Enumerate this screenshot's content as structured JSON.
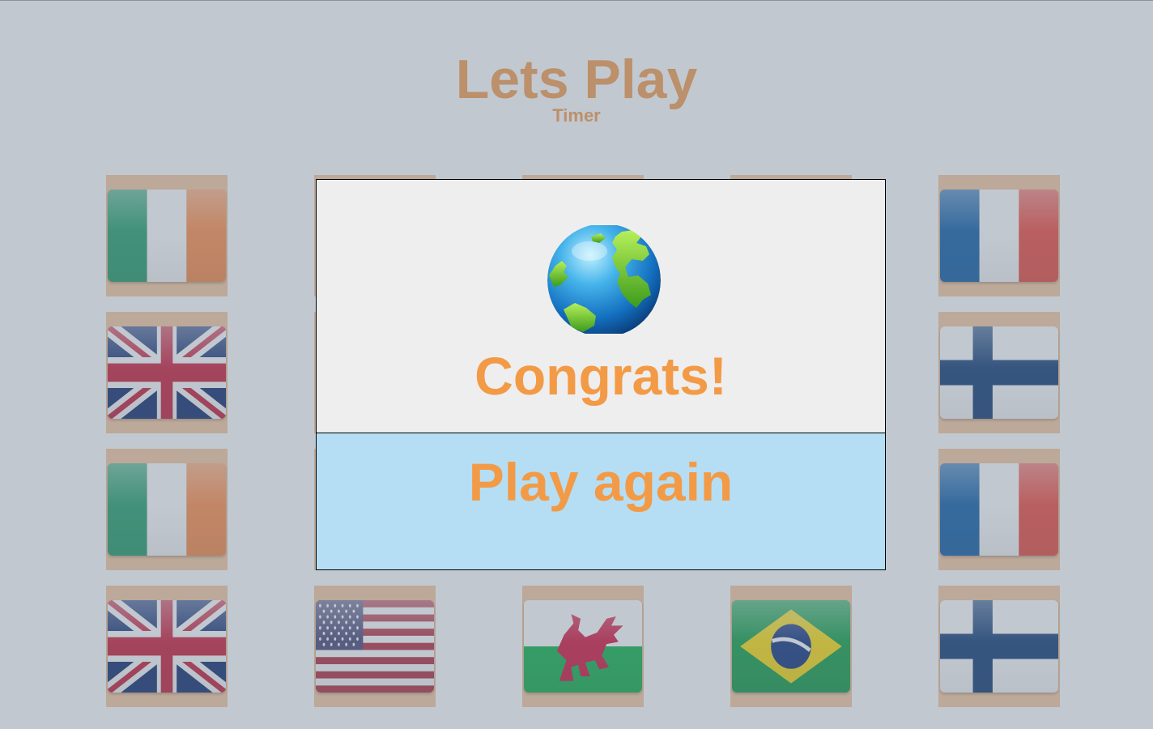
{
  "game": {
    "title": "Lets Play",
    "subtitle": "Timer"
  },
  "cards": [
    {
      "flag": "ireland-flag"
    },
    {
      "flag": "hidden"
    },
    {
      "flag": "hidden"
    },
    {
      "flag": "hidden"
    },
    {
      "flag": "france-flag"
    },
    {
      "flag": "united-kingdom-flag"
    },
    {
      "flag": "hidden"
    },
    {
      "flag": "hidden"
    },
    {
      "flag": "hidden"
    },
    {
      "flag": "finland-flag"
    },
    {
      "flag": "ireland-flag"
    },
    {
      "flag": "hidden"
    },
    {
      "flag": "hidden"
    },
    {
      "flag": "hidden"
    },
    {
      "flag": "france-flag"
    },
    {
      "flag": "united-kingdom-flag"
    },
    {
      "flag": "united-states-flag"
    },
    {
      "flag": "wales-flag"
    },
    {
      "flag": "brazil-flag"
    },
    {
      "flag": "finland-flag"
    }
  ],
  "modal": {
    "icon": "globe-icon",
    "message": "Congrats!",
    "button_label": "Play again"
  },
  "colors": {
    "accent": "#f39a46",
    "card_background": "#f5c79b",
    "button_background": "#b5def4",
    "modal_background": "#eeeeee",
    "overlay": "#c1c7ce"
  }
}
